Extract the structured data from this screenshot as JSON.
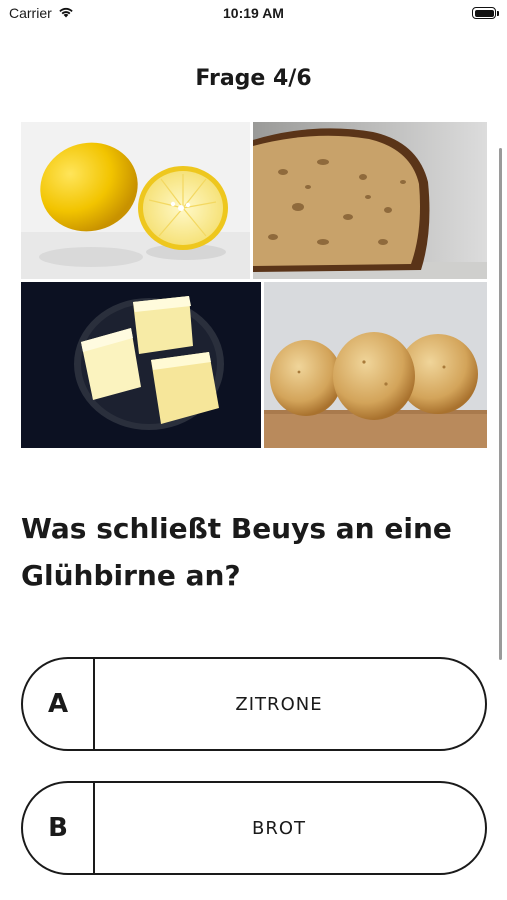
{
  "status_bar": {
    "carrier": "Carrier",
    "time": "10:19 AM"
  },
  "header": {
    "title": "Frage 4/6"
  },
  "images": [
    {
      "subject": "lemon"
    },
    {
      "subject": "bread"
    },
    {
      "subject": "butter"
    },
    {
      "subject": "potatoes"
    }
  ],
  "question": {
    "text": "Was schließt Beuys an eine Glühbirne an?"
  },
  "answers": [
    {
      "letter": "A",
      "label": "ZITRONE"
    },
    {
      "letter": "B",
      "label": "BROT"
    }
  ],
  "colors": {
    "text": "#1a1a1a",
    "background": "#ffffff",
    "border": "#1a1a1a"
  }
}
